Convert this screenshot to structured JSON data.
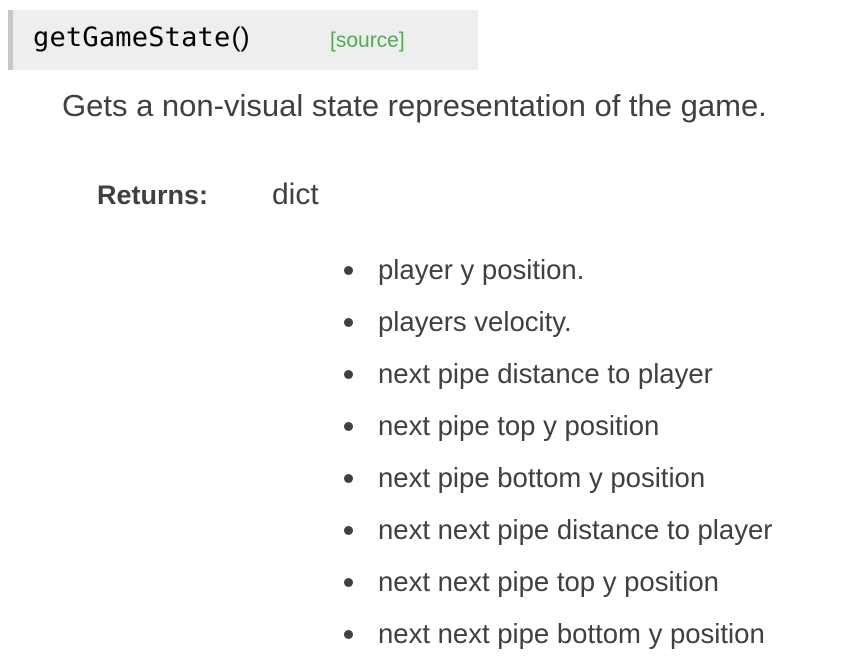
{
  "signature": {
    "name": "getGameState",
    "parens": "()",
    "source_link": "[source]"
  },
  "description": "Gets a non-visual state representation of the game.",
  "returns": {
    "label": "Returns:",
    "type": "dict",
    "items": [
      "player y position.",
      "players velocity.",
      "next pipe distance to player",
      "next pipe top y position",
      "next pipe bottom y position",
      "next next pipe distance to player",
      "next next pipe top y position",
      "next next pipe bottom y position"
    ]
  },
  "colors": {
    "source_link": "#4caf50",
    "text": "#404040",
    "signature_bg": "#eeeeee"
  }
}
